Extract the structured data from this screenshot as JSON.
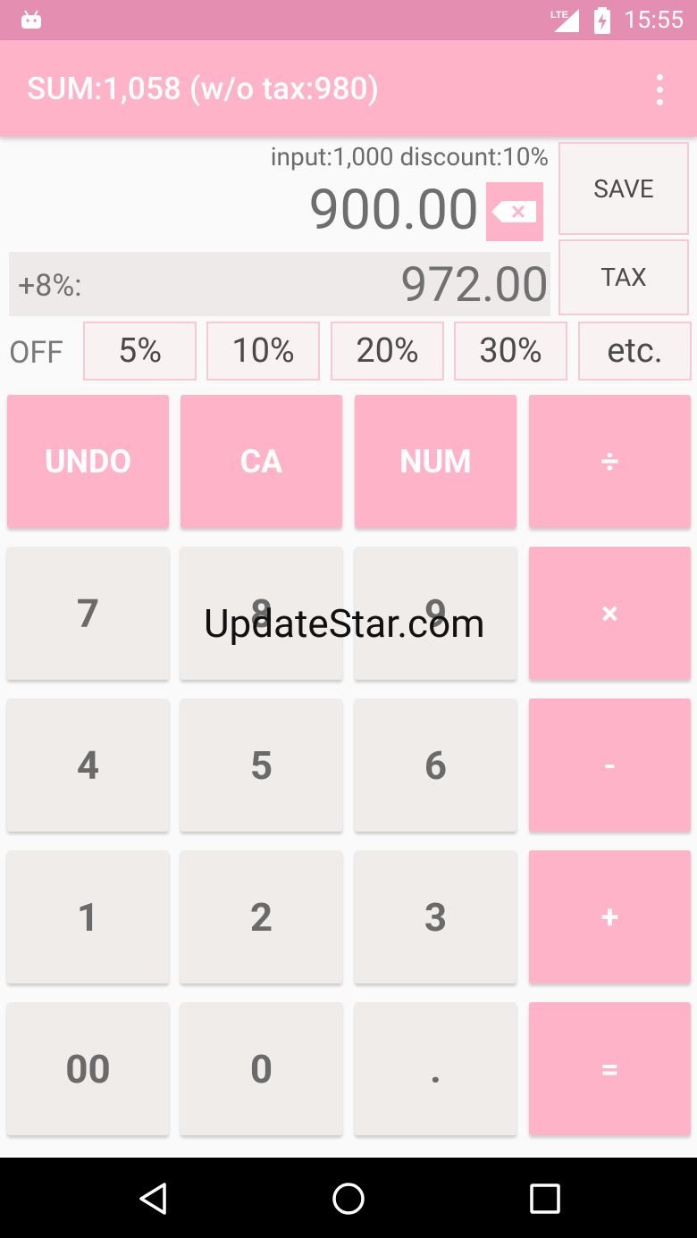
{
  "status_bar": {
    "network": "LTE",
    "time": "15:55"
  },
  "app_bar": {
    "title": "SUM:1,058 (w/o tax:980)"
  },
  "display": {
    "info": "input:1,000  discount:10%",
    "value": "900.00",
    "tax_label": "+8%:",
    "tax_value": "972.00"
  },
  "side": {
    "save": "SAVE",
    "tax": "TAX"
  },
  "discount": {
    "off": "OFF",
    "options": [
      "5%",
      "10%",
      "20%",
      "30%",
      "etc."
    ]
  },
  "keys": [
    [
      "UNDO",
      "CA",
      "NUM",
      "÷"
    ],
    [
      "7",
      "8",
      "9",
      "×"
    ],
    [
      "4",
      "5",
      "6",
      "-"
    ],
    [
      "1",
      "2",
      "3",
      "+"
    ],
    [
      "00",
      "0",
      ".",
      "="
    ]
  ],
  "watermark": "UpdateStar.com",
  "colors": {
    "accent": "#ffb3c9",
    "status_bar": "#e48fb1",
    "key_gray": "#f0ecea",
    "text_gray": "#6a6a6a"
  }
}
